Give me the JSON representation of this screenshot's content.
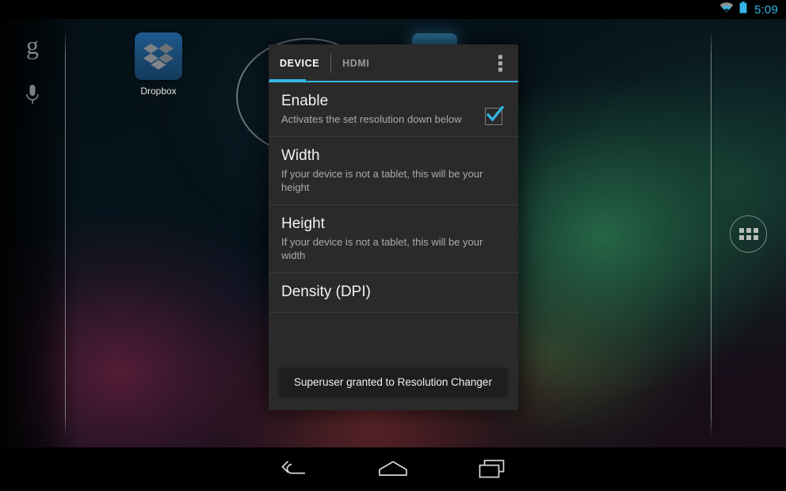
{
  "status_bar": {
    "wifi_icon": "wifi-icon",
    "battery_icon": "battery-icon",
    "clock": "5:09"
  },
  "home_screen": {
    "search_icon": "google-g-icon",
    "voice_search_icon": "microphone-icon",
    "apps": [
      {
        "name": "Dropbox",
        "icon": "dropbox-icon"
      }
    ],
    "app_drawer_label": "app-drawer-icon"
  },
  "dialog": {
    "tabs": [
      {
        "label": "DEVICE",
        "active": true
      },
      {
        "label": "HDMI",
        "active": false
      }
    ],
    "overflow_icon": "overflow-menu-icon",
    "preferences": [
      {
        "title": "Enable",
        "subtitle": "Activates the set resolution down below",
        "has_checkbox": true,
        "checked": true
      },
      {
        "title": "Width",
        "subtitle": "If your device is not a tablet, this will be your height",
        "has_checkbox": false
      },
      {
        "title": "Height",
        "subtitle": "If your device is not a tablet, this will be your width",
        "has_checkbox": false
      },
      {
        "title": "Density (DPI)",
        "subtitle": "",
        "has_checkbox": false
      }
    ],
    "toast": "Superuser granted to Resolution Changer"
  },
  "nav_bar": {
    "back": "back-icon",
    "home": "home-icon",
    "recents": "recents-icon"
  },
  "colors": {
    "accent": "#33b5e5",
    "dialog_bg": "#2a2a2a",
    "divider": "#3b3b3b",
    "title_text": "#f2f2f2",
    "sub_text": "#a8acac",
    "status_black": "#000000"
  }
}
